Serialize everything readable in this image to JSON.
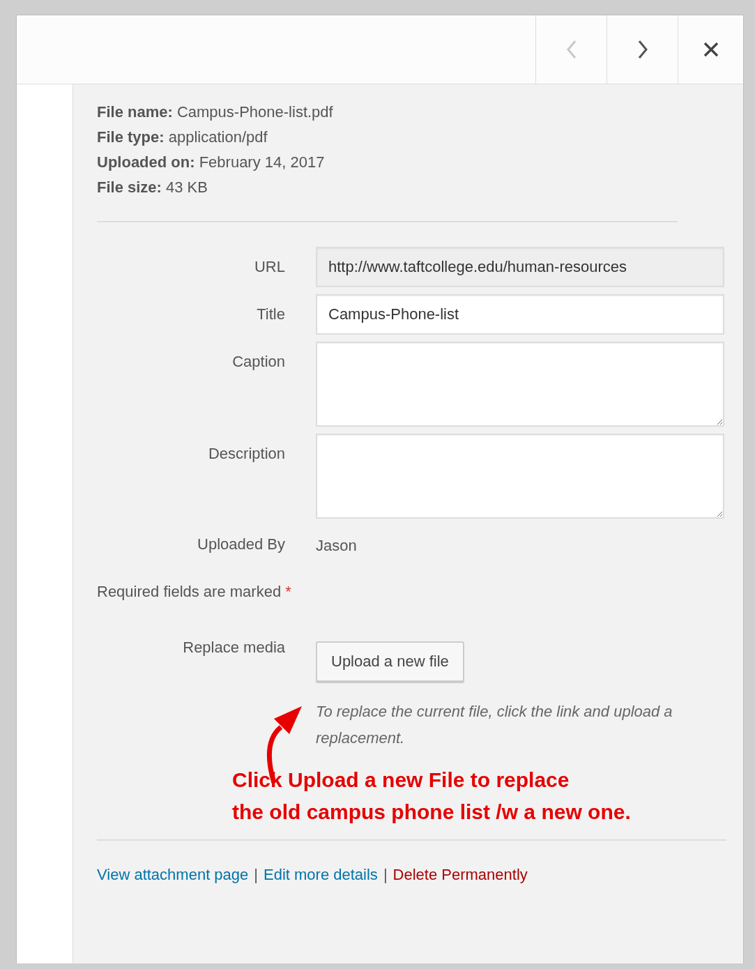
{
  "nav_buttons": [
    {
      "kind": "prev",
      "disabled": true
    },
    {
      "kind": "next",
      "disabled": false
    },
    {
      "kind": "close"
    }
  ],
  "details": [
    {
      "label": "File name:",
      "value": "Campus-Phone-list.pdf"
    },
    {
      "label": "File type:",
      "value": "application/pdf"
    },
    {
      "label": "Uploaded on:",
      "value": "February 14, 2017"
    },
    {
      "label": "File size:",
      "value": "43 KB"
    }
  ],
  "fields": [
    {
      "kind": "text",
      "label": "URL",
      "value": "http://www.taftcollege.edu/human-resources",
      "readonly": true
    },
    {
      "kind": "text",
      "label": "Title",
      "value": "Campus-Phone-list",
      "readonly": false
    },
    {
      "kind": "textarea",
      "label": "Caption"
    },
    {
      "kind": "textarea",
      "label": "Description"
    },
    {
      "kind": "static",
      "label": "Uploaded By",
      "value": "Jason"
    }
  ],
  "required": {
    "text": "Required fields are marked",
    "mark": "*"
  },
  "replace": {
    "label": "Replace media",
    "button": "Upload a new file",
    "help": "To replace the current file, click the link and upload a replacement."
  },
  "annotation": {
    "lines": [
      "Click Upload a new File to replace",
      "the old campus phone list /w a new one."
    ]
  },
  "links": [
    {
      "kind": "link",
      "text": "View attachment page"
    },
    {
      "kind": "link",
      "text": "Edit more details"
    },
    {
      "kind": "delete",
      "text": "Delete Permanently"
    }
  ],
  "link_separator": "|"
}
